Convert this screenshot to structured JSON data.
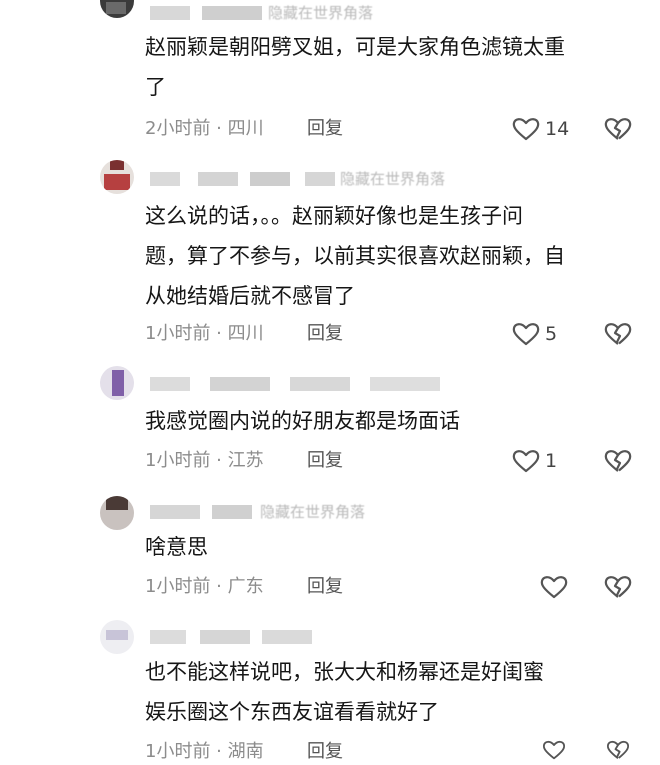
{
  "comments": [
    {
      "name_tail": "隐藏在世界角落",
      "text_lines": [
        "赵丽颖是朝阳劈叉姐，可是大家角色滤镜太重",
        "了"
      ],
      "meta": "2小时前 · 四川",
      "reply": "回复",
      "likes": "14"
    },
    {
      "name_tail": "隐藏在世界角落",
      "text_lines": [
        "这么说的话，。。赵丽颖好像也是生孩子问",
        "题，算了不参与，以前其实很喜欢赵丽颖，自",
        "从她结婚后就不感冒了"
      ],
      "meta": "1小时前 · 四川",
      "reply": "回复",
      "likes": "5"
    },
    {
      "name_tail": "",
      "text_lines": [
        "我感觉圈内说的好朋友都是场面话"
      ],
      "meta": "1小时前 · 江苏",
      "reply": "回复",
      "likes": "1"
    },
    {
      "name_tail": "隐藏在世界角落",
      "text_lines": [
        "啥意思"
      ],
      "meta": "1小时前 · 广东",
      "reply": "回复",
      "likes": ""
    },
    {
      "name_tail": "",
      "text_lines": [
        "也不能这样说吧，张大大和杨幂还是好闺蜜",
        "娱乐圈这个东西友谊看看就好了"
      ],
      "meta": "1小时前 · 湖南",
      "reply": "回复",
      "likes": ""
    }
  ],
  "icons": {
    "like": "heart-outline-icon",
    "dislike": "broken-heart-icon"
  },
  "colors": {
    "text": "#161616",
    "meta": "#8c8c8c",
    "reply": "#555555",
    "icon": "#555555"
  }
}
